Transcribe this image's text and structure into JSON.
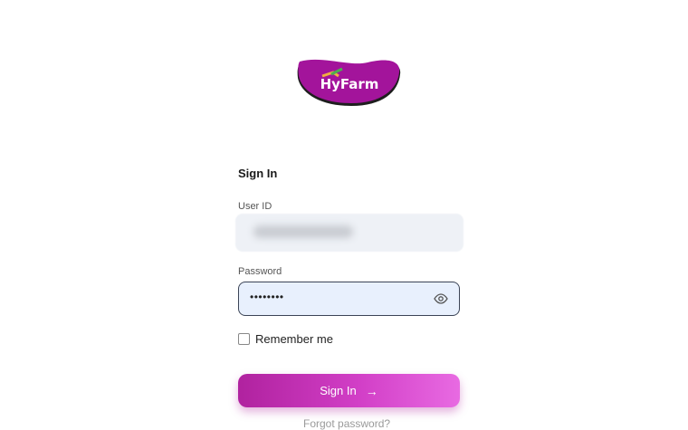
{
  "brand": {
    "logo_text": "HyFarm",
    "colors": {
      "blob": "#a3149b",
      "shadow": "#2a2a2a"
    }
  },
  "form": {
    "title": "Sign In",
    "user_id_label": "User ID",
    "password_label": "Password",
    "password_value": "••••••••",
    "remember_label": "Remember me",
    "remember_checked": false,
    "submit_label": "Sign In",
    "submit_arrow": "→",
    "forgot_label": "Forgot password?"
  },
  "colors": {
    "accent": "#c93bbf",
    "input_bg": "#e8f0fd"
  }
}
